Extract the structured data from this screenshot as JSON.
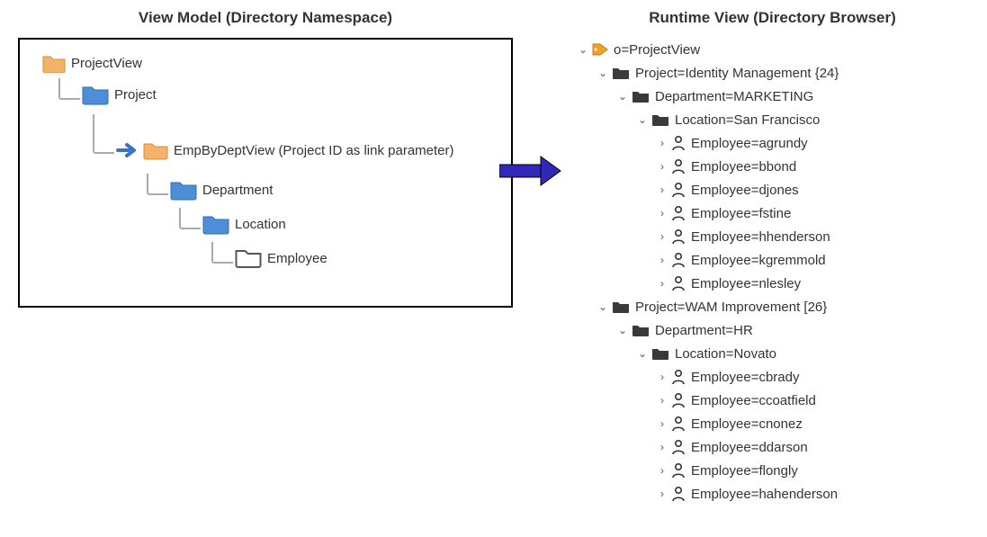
{
  "left": {
    "title": "View Model (Directory Namespace)",
    "nodes": {
      "root": "ProjectView",
      "project": "Project",
      "linkview": "EmpByDeptView (Project ID as link parameter)",
      "department": "Department",
      "location": "Location",
      "employee": "Employee"
    }
  },
  "right": {
    "title": "Runtime View (Directory Browser)",
    "root": "o=ProjectView",
    "projects": [
      {
        "label": "Project=Identity Management {24}",
        "dept": "Department=MARKETING",
        "loc": "Location=San Francisco",
        "employees": [
          "Employee=agrundy",
          "Employee=bbond",
          "Employee=djones",
          "Employee=fstine",
          "Employee=hhenderson",
          "Employee=kgremmold",
          "Employee=nlesley"
        ]
      },
      {
        "label": "Project=WAM Improvement [26}",
        "dept": "Department=HR",
        "loc": "Location=Novato",
        "employees": [
          "Employee=cbrady",
          "Employee=ccoatfield",
          "Employee=cnonez",
          "Employee=ddarson",
          "Employee=flongly",
          "Employee=hahenderson"
        ]
      }
    ]
  }
}
